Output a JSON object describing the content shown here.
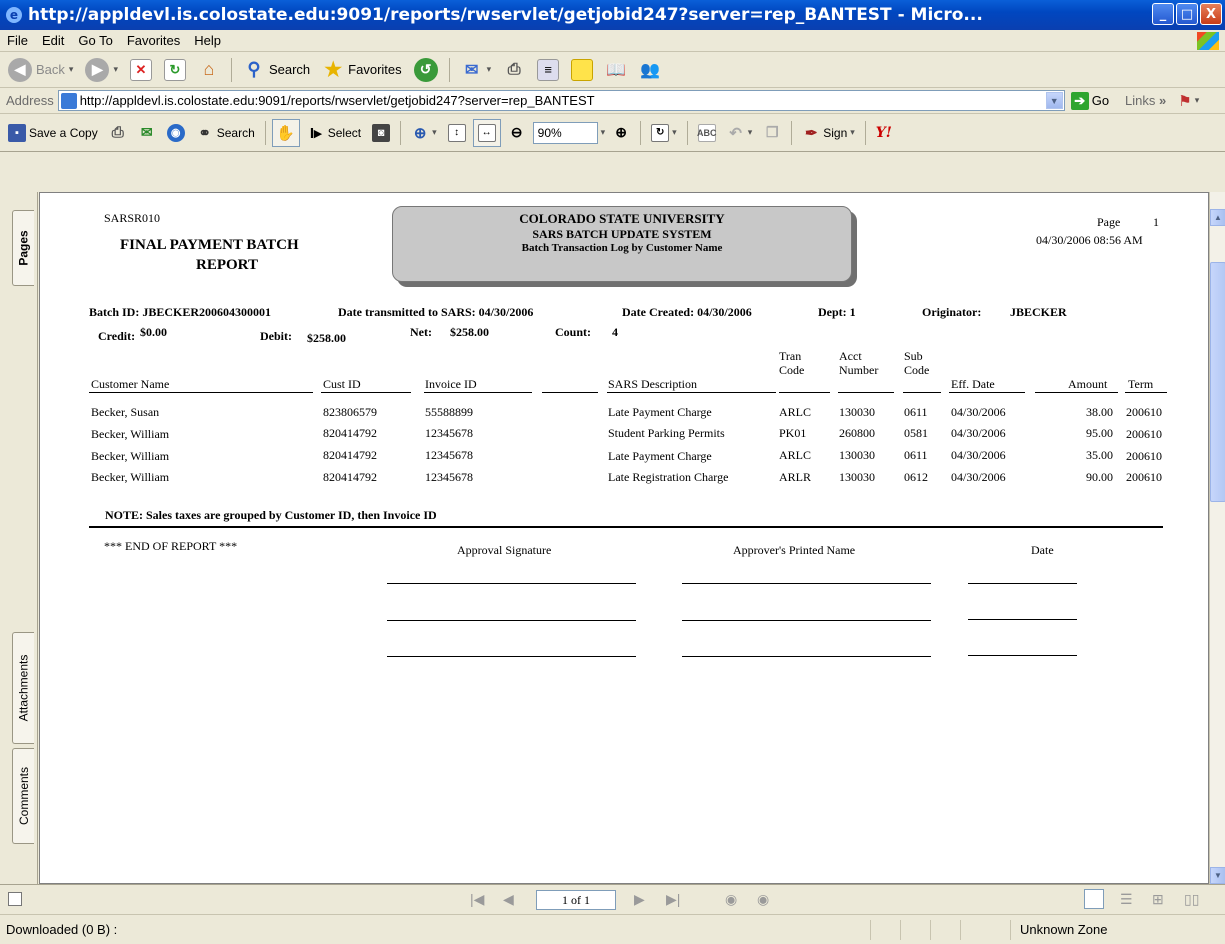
{
  "window": {
    "title": "http://appldevl.is.colostate.edu:9091/reports/rwservlet/getjobid247?server=rep_BANTEST - Micro...",
    "minimize": "_",
    "maximize": "□",
    "close": "X"
  },
  "menu": [
    "File",
    "Edit",
    "Go To",
    "Favorites",
    "Help"
  ],
  "toolbar": {
    "back": "Back",
    "search": "Search",
    "favorites": "Favorites"
  },
  "address": {
    "label": "Address",
    "url": "http://appldevl.is.colostate.edu:9091/reports/rwservlet/getjobid247?server=rep_BANTEST",
    "go": "Go",
    "links": "Links"
  },
  "acrobat": {
    "save_copy": "Save a Copy",
    "search": "Search",
    "select": "Select",
    "zoom": "90%",
    "sign": "Sign"
  },
  "nav_tabs": {
    "pages": "Pages",
    "attachments": "Attachments",
    "comments": "Comments"
  },
  "report": {
    "code": "SARSR010",
    "title_line1": "FINAL PAYMENT BATCH",
    "title_line2": "REPORT",
    "banner": [
      "COLORADO STATE UNIVERSITY",
      "SARS BATCH UPDATE SYSTEM",
      "Batch Transaction Log by Customer Name"
    ],
    "page_label": "Page",
    "page_num": "1",
    "run_datetime": "04/30/2006 08:56 AM",
    "batch_id": "Batch ID: JBECKER200604300001",
    "date_transmitted": "Date transmitted to SARS:  04/30/2006",
    "date_created": "Date Created: 04/30/2006",
    "dept": "Dept: 1",
    "originator_label": "Originator:",
    "originator": "JBECKER",
    "credit_label": "Credit:",
    "credit": "$0.00",
    "debit_label": "Debit:",
    "debit": "$258.00",
    "net_label": "Net:",
    "net": "$258.00",
    "count_label": "Count:",
    "count": "4",
    "columns": {
      "customer": "Customer Name",
      "cust_id": "Cust ID",
      "invoice": "Invoice ID",
      "description": "SARS Description",
      "tran1": "Tran",
      "tran2": "Code",
      "acct1": "Acct",
      "acct2": "Number",
      "sub1": "Sub",
      "sub2": "Code",
      "eff": "Eff. Date",
      "amount": "Amount",
      "term": "Term"
    },
    "rows": [
      {
        "customer": "Becker, Susan",
        "cust_id": "823806579",
        "invoice": "55588899",
        "description": "Late Payment Charge",
        "tran": "ARLC",
        "acct": "130030",
        "sub": "0611",
        "eff": "04/30/2006",
        "amount": "38.00",
        "term": "200610"
      },
      {
        "customer": "Becker, William",
        "cust_id": "820414792",
        "invoice": "12345678",
        "description": "Student Parking Permits",
        "tran": "PK01",
        "acct": "260800",
        "sub": "0581",
        "eff": "04/30/2006",
        "amount": "95.00",
        "term": "200610"
      },
      {
        "customer": "Becker, William",
        "cust_id": "820414792",
        "invoice": "12345678",
        "description": "Late Payment Charge",
        "tran": "ARLC",
        "acct": "130030",
        "sub": "0611",
        "eff": "04/30/2006",
        "amount": "35.00",
        "term": "200610"
      },
      {
        "customer": "Becker, William",
        "cust_id": "820414792",
        "invoice": "12345678",
        "description": "Late Registration Charge",
        "tran": "ARLR",
        "acct": "130030",
        "sub": "0612",
        "eff": "04/30/2006",
        "amount": "90.00",
        "term": "200610"
      }
    ],
    "note": "NOTE:  Sales taxes are grouped by Customer ID, then Invoice ID",
    "end": "*** END OF REPORT ***",
    "approval_signature": "Approval Signature",
    "approver_name": "Approver's Printed Name",
    "date_label": "Date"
  },
  "pager": {
    "page_of": "1 of 1"
  },
  "status": {
    "left": "Downloaded  (0 B) :",
    "zone": "Unknown Zone"
  }
}
